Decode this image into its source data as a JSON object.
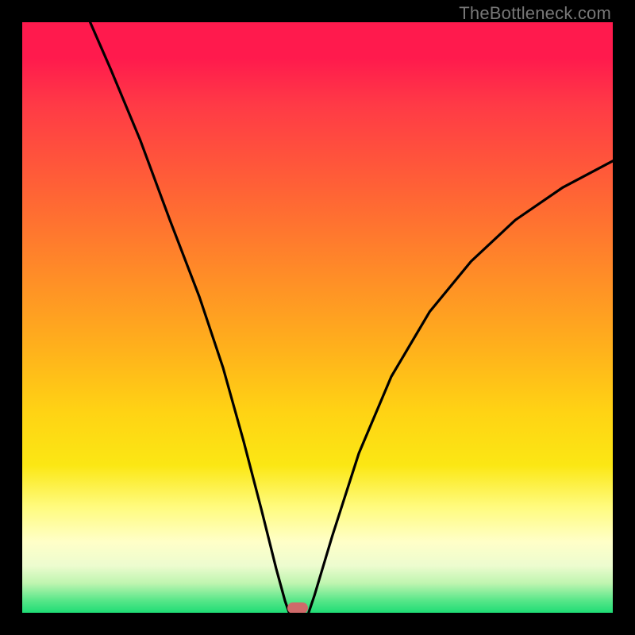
{
  "watermark": "TheBottleneck.com",
  "chart_data": {
    "type": "line",
    "title": "",
    "xlabel": "",
    "ylabel": "",
    "xlim": [
      0,
      1
    ],
    "ylim": [
      0,
      1
    ],
    "curve_left": {
      "name": "left-branch",
      "points": [
        {
          "x": 0.115,
          "y": 1.0
        },
        {
          "x": 0.15,
          "y": 0.92
        },
        {
          "x": 0.2,
          "y": 0.8
        },
        {
          "x": 0.25,
          "y": 0.665
        },
        {
          "x": 0.3,
          "y": 0.535
        },
        {
          "x": 0.34,
          "y": 0.415
        },
        {
          "x": 0.375,
          "y": 0.29
        },
        {
          "x": 0.405,
          "y": 0.175
        },
        {
          "x": 0.43,
          "y": 0.075
        },
        {
          "x": 0.445,
          "y": 0.02
        },
        {
          "x": 0.452,
          "y": 0.0
        }
      ]
    },
    "curve_right": {
      "name": "right-branch",
      "points": [
        {
          "x": 0.485,
          "y": 0.0
        },
        {
          "x": 0.495,
          "y": 0.03
        },
        {
          "x": 0.525,
          "y": 0.13
        },
        {
          "x": 0.57,
          "y": 0.27
        },
        {
          "x": 0.625,
          "y": 0.4
        },
        {
          "x": 0.69,
          "y": 0.51
        },
        {
          "x": 0.76,
          "y": 0.595
        },
        {
          "x": 0.835,
          "y": 0.665
        },
        {
          "x": 0.915,
          "y": 0.72
        },
        {
          "x": 1.0,
          "y": 0.765
        }
      ]
    },
    "marker": {
      "x": 0.467,
      "y": 0.0
    }
  }
}
